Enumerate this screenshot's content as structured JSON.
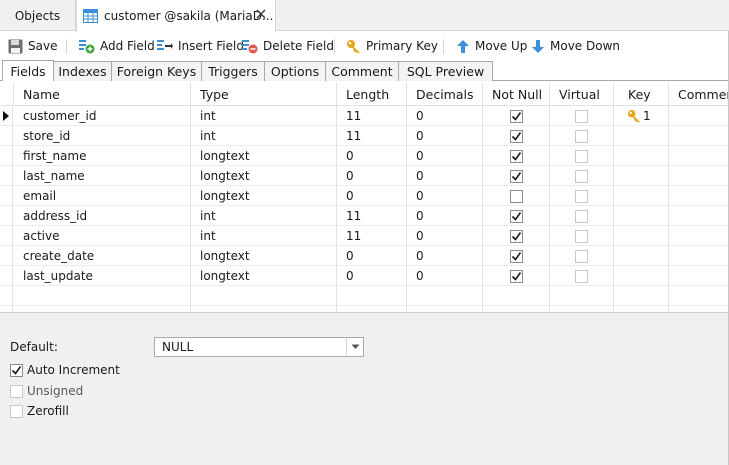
{
  "doc_tabs": {
    "objects_label": "Objects",
    "active_label": "customer @sakila (MariaD..."
  },
  "toolbar": {
    "save": "Save",
    "add_field": "Add Field",
    "insert_field": "Insert Field",
    "delete_field": "Delete Field",
    "primary_key": "Primary Key",
    "move_up": "Move Up",
    "move_down": "Move Down"
  },
  "sub_tabs": [
    "Fields",
    "Indexes",
    "Foreign Keys",
    "Triggers",
    "Options",
    "Comment",
    "SQL Preview"
  ],
  "grid": {
    "columns": [
      "Name",
      "Type",
      "Length",
      "Decimals",
      "Not Null",
      "Virtual",
      "Key",
      "Comment"
    ],
    "rows": [
      {
        "name": "customer_id",
        "type": "int",
        "length": "11",
        "decimals": "0",
        "not_null": true,
        "virtual": false,
        "key": "1"
      },
      {
        "name": "store_id",
        "type": "int",
        "length": "11",
        "decimals": "0",
        "not_null": true,
        "virtual": false,
        "key": ""
      },
      {
        "name": "first_name",
        "type": "longtext",
        "length": "0",
        "decimals": "0",
        "not_null": true,
        "virtual": false,
        "key": ""
      },
      {
        "name": "last_name",
        "type": "longtext",
        "length": "0",
        "decimals": "0",
        "not_null": true,
        "virtual": false,
        "key": ""
      },
      {
        "name": "email",
        "type": "longtext",
        "length": "0",
        "decimals": "0",
        "not_null": false,
        "virtual": false,
        "key": ""
      },
      {
        "name": "address_id",
        "type": "int",
        "length": "11",
        "decimals": "0",
        "not_null": true,
        "virtual": false,
        "key": ""
      },
      {
        "name": "active",
        "type": "int",
        "length": "11",
        "decimals": "0",
        "not_null": true,
        "virtual": false,
        "key": ""
      },
      {
        "name": "create_date",
        "type": "longtext",
        "length": "0",
        "decimals": "0",
        "not_null": true,
        "virtual": false,
        "key": ""
      },
      {
        "name": "last_update",
        "type": "longtext",
        "length": "0",
        "decimals": "0",
        "not_null": true,
        "virtual": false,
        "key": ""
      }
    ]
  },
  "bottom": {
    "default_label": "Default:",
    "default_value": "NULL",
    "auto_increment_label": "Auto Increment",
    "auto_increment_checked": true,
    "unsigned_label": "Unsigned",
    "unsigned_checked": false,
    "zerofill_label": "Zerofill",
    "zerofill_checked": false
  },
  "colors": {
    "accent_blue": "#3c8fd6",
    "add_green": "#3aa43a",
    "delete_red": "#e05a4e",
    "key_gold": "#e8a317"
  }
}
